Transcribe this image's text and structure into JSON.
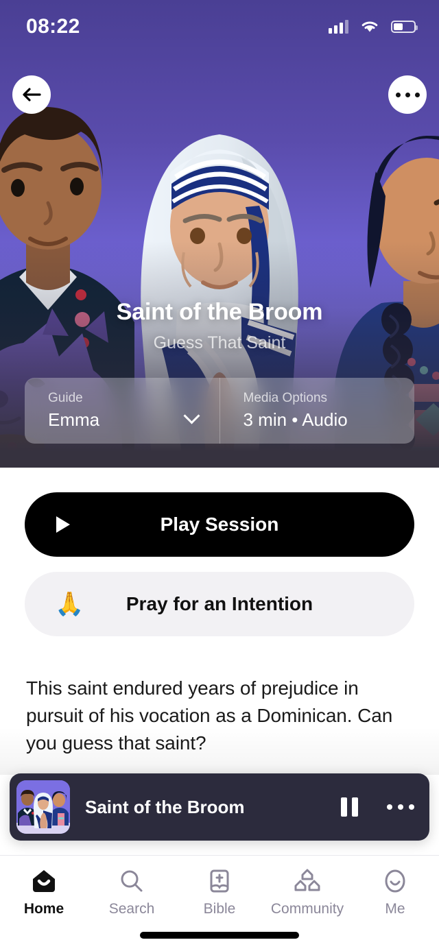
{
  "status_bar": {
    "time": "08:22",
    "signal_icon": "cellular-signal-icon",
    "wifi_icon": "wifi-icon",
    "battery_icon": "battery-icon"
  },
  "hero": {
    "back_icon": "back-arrow-icon",
    "more_icon": "more-options-icon",
    "title": "Saint of the Broom",
    "subtitle": "Guess That Saint",
    "gradient_top": "#4a3f94",
    "gradient_bottom": "#7b6fe2",
    "overlay_color": "#36323f",
    "controls": [
      {
        "label": "Guide",
        "value": "Emma",
        "has_chevron": true,
        "chevron_icon": "chevron-down-icon"
      },
      {
        "label": "Media Options",
        "value": "3 min • Audio",
        "has_chevron": false
      }
    ]
  },
  "actions": {
    "play": {
      "label": "Play Session",
      "icon": "play-icon",
      "bg": "#000000",
      "fg": "#ffffff"
    },
    "pray": {
      "label": "Pray for an Intention",
      "icon": "praying-hands-icon",
      "glyph": "🙏",
      "bg": "#f2f1f4",
      "fg": "#111111"
    }
  },
  "description": "This saint endured years of prejudice in pursuit of his vocation as a Dominican. Can you guess that saint?",
  "mini_player": {
    "title": "Saint of the Broom",
    "thumbnail_icon": "session-artwork-thumbnail",
    "pause_icon": "pause-icon",
    "more_icon": "more-options-icon",
    "bg": "#2c2b3d"
  },
  "tab_bar": {
    "active": "Home",
    "items": [
      {
        "label": "Home",
        "icon": "home-icon",
        "active": true
      },
      {
        "label": "Search",
        "icon": "search-icon",
        "active": false
      },
      {
        "label": "Bible",
        "icon": "bible-icon",
        "active": false
      },
      {
        "label": "Community",
        "icon": "community-icon",
        "active": false
      },
      {
        "label": "Me",
        "icon": "profile-icon",
        "active": false
      }
    ],
    "inactive_color": "#8b8799",
    "active_color": "#111111"
  }
}
